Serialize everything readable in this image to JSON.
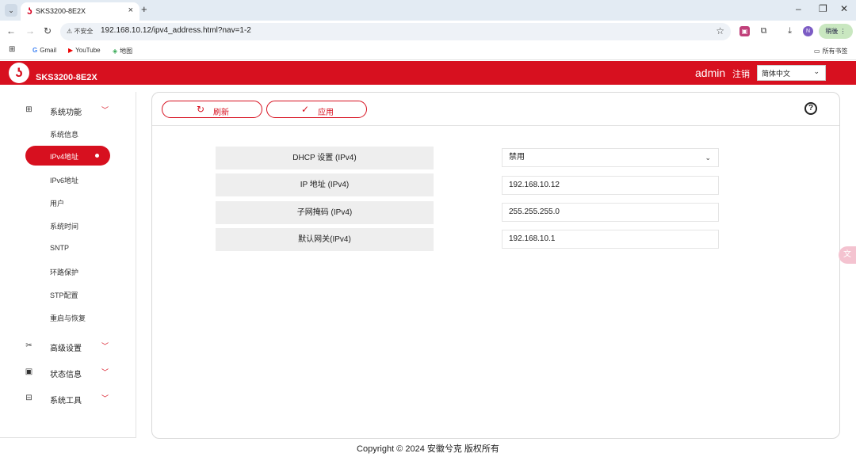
{
  "browser": {
    "tab_title": "SKS3200-8E2X",
    "tab_close": "×",
    "new_tab": "+",
    "tab_menu": "⌄",
    "security": "⚠ 不安全",
    "url": "192.168.10.12/ipv4_address.html?nav=1-2",
    "update_label": "稍後",
    "profile_initial": "N",
    "bookmarks": [
      {
        "icon": "G",
        "label": "Gmail"
      },
      {
        "icon": "▶",
        "label": "YouTube"
      },
      {
        "icon": "◈",
        "label": "地图"
      }
    ],
    "all_bookmarks": "所有书签"
  },
  "header": {
    "model": "SKS3200-8E2X",
    "user": "admin",
    "logout": "注销",
    "language": "简体中文"
  },
  "sidebar": {
    "groups": [
      {
        "label": "系统功能",
        "icon": "grid-icon"
      },
      {
        "label": "高级设置",
        "icon": "tools-icon"
      },
      {
        "label": "状态信息",
        "icon": "monitor-icon"
      },
      {
        "label": "系统工具",
        "icon": "toolbox-icon"
      }
    ],
    "items": [
      {
        "label": "系统信息"
      },
      {
        "label": "IPv4地址"
      },
      {
        "label": "IPv6地址"
      },
      {
        "label": "用户"
      },
      {
        "label": "系统时间"
      },
      {
        "label": "SNTP"
      },
      {
        "label": "环路保护"
      },
      {
        "label": "STP配置"
      },
      {
        "label": "重启与恢复"
      }
    ]
  },
  "toolbar": {
    "refresh": "刷新",
    "apply": "应用",
    "help": "?"
  },
  "form": {
    "rows": [
      {
        "label": "DHCP 设置 (IPv4)",
        "value": "禁用"
      },
      {
        "label": "IP 地址 (IPv4)",
        "value": "192.168.10.12"
      },
      {
        "label": "子网掩码 (IPv4)",
        "value": "255.255.255.0"
      },
      {
        "label": "默认网关(IPv4)",
        "value": "192.168.10.1"
      }
    ]
  },
  "footer": {
    "copyright": "Copyright © 2024 安徽兮克 版权所有"
  },
  "colors": {
    "brand": "#d7101f"
  }
}
